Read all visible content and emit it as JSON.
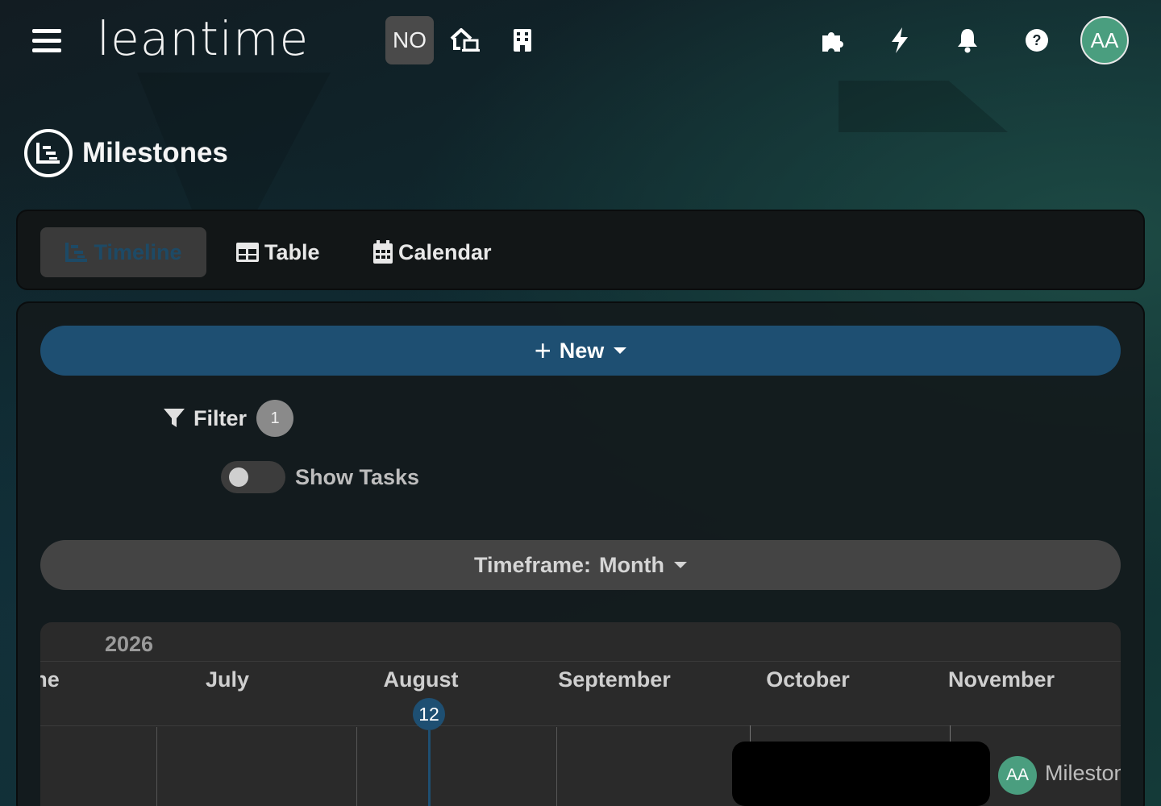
{
  "header": {
    "logo": "leantime",
    "project_badge": "NO",
    "user_initials": "AA",
    "icons": [
      "menu-icon",
      "home-icon",
      "building-icon",
      "puzzle-icon",
      "bolt-icon",
      "bell-icon",
      "help-icon"
    ]
  },
  "page": {
    "title": "Milestones",
    "title_icon": "timeline-icon"
  },
  "tabs": [
    {
      "label": "Timeline",
      "icon": "timeline-icon",
      "active": true
    },
    {
      "label": "Table",
      "icon": "table-icon",
      "active": false
    },
    {
      "label": "Calendar",
      "icon": "calendar-icon",
      "active": false
    }
  ],
  "toolbar": {
    "new_label": "New",
    "filter_label": "Filter",
    "filter_count": "1",
    "show_tasks_label": "Show Tasks",
    "show_tasks_on": false,
    "timeframe_label": "Timeframe:",
    "timeframe_value": "Month"
  },
  "gantt": {
    "year": "2026",
    "months": [
      "June",
      "July",
      "August",
      "September",
      "October",
      "November"
    ],
    "visible_month_texts": [
      "ne",
      "July",
      "August",
      "September",
      "October",
      "November"
    ],
    "today_label": "12",
    "milestone": {
      "owner_initials": "AA",
      "label": "Milestone"
    }
  },
  "colors": {
    "accent": "#1e4f72",
    "avatar": "#4a9e7f",
    "card": "#121617"
  }
}
